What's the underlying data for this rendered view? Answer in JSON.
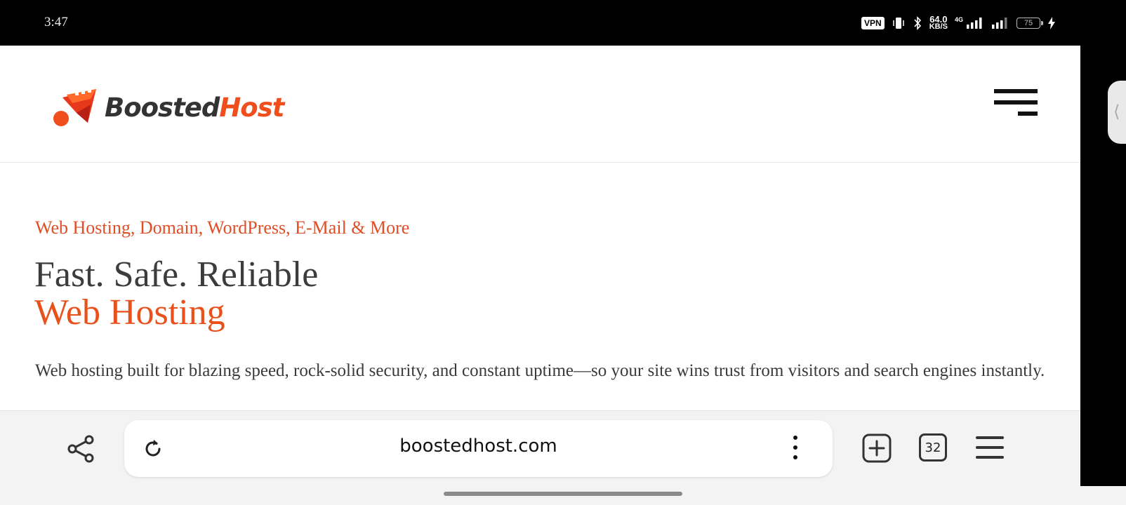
{
  "status_bar": {
    "time": "3:47",
    "vpn": "VPN",
    "net_speed_value": "64.0",
    "net_speed_unit": "KB/S",
    "network_type": "4G",
    "battery": "75"
  },
  "site": {
    "logo_part1": "Boosted",
    "logo_part2": "Host",
    "accent_color": "#f04e1c",
    "tagline": "Web Hosting, Domain, WordPress, E-Mail & More",
    "heading_line1": "Fast. Safe. Reliable",
    "heading_line2": "Web Hosting",
    "description": "Web hosting built for blazing speed, rock-solid security, and constant uptime—so your site wins trust from visitors and search engines instantly."
  },
  "browser": {
    "url": "boostedhost.com",
    "tab_count": "32"
  },
  "edge_handle_glyph": "⟨",
  "icons": {
    "share": "share-icon",
    "reload": "reload-icon",
    "more": "more-vertical-icon",
    "new_tab": "new-tab-icon",
    "tabs": "tabs-icon",
    "menu": "menu-icon",
    "hamburger": "hamburger-menu-icon"
  }
}
